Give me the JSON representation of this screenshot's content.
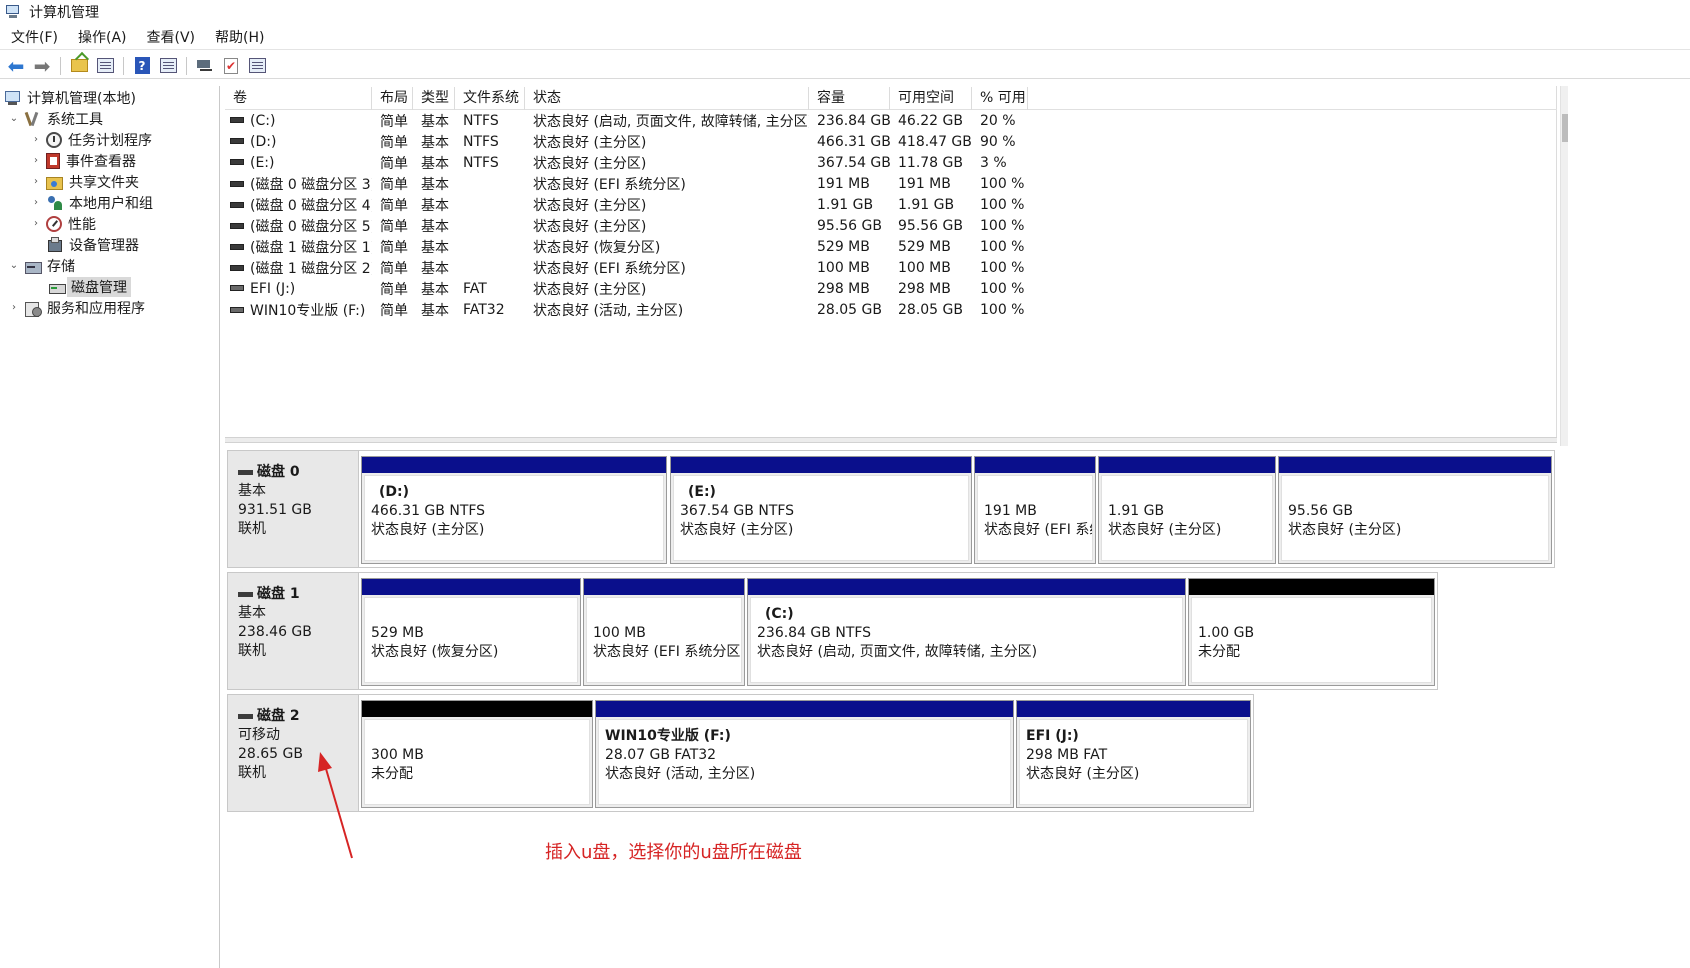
{
  "window": {
    "title": "计算机管理"
  },
  "menu": [
    "文件(F)",
    "操作(A)",
    "查看(V)",
    "帮助(H)"
  ],
  "toolbar": {
    "icons": [
      "back-arrow-icon",
      "forward-arrow-icon",
      "up-folder-icon",
      "show-tree-icon",
      "help-icon",
      "properties-icon",
      "connect-icon",
      "check-icon",
      "settings-icon"
    ]
  },
  "tree": {
    "root": "计算机管理(本地)",
    "system_tools": "系统工具",
    "task_scheduler": "任务计划程序",
    "event_viewer": "事件查看器",
    "shared_folders": "共享文件夹",
    "local_users": "本地用户和组",
    "performance": "性能",
    "device_manager": "设备管理器",
    "storage": "存储",
    "disk_management": "磁盘管理",
    "services": "服务和应用程序"
  },
  "volume_table": {
    "headers": [
      "卷",
      "布局",
      "类型",
      "文件系统",
      "状态",
      "容量",
      "可用空间",
      "% 可用"
    ],
    "rows": [
      [
        "(C:)",
        "简单",
        "基本",
        "NTFS",
        "状态良好 (启动, 页面文件, 故障转储, 主分区)",
        "236.84 GB",
        "46.22 GB",
        "20 %"
      ],
      [
        "(D:)",
        "简单",
        "基本",
        "NTFS",
        "状态良好 (主分区)",
        "466.31 GB",
        "418.47 GB",
        "90 %"
      ],
      [
        "(E:)",
        "简单",
        "基本",
        "NTFS",
        "状态良好 (主分区)",
        "367.54 GB",
        "11.78 GB",
        "3 %"
      ],
      [
        "(磁盘 0 磁盘分区 3)",
        "简单",
        "基本",
        "",
        "状态良好 (EFI 系统分区)",
        "191 MB",
        "191 MB",
        "100 %"
      ],
      [
        "(磁盘 0 磁盘分区 4)",
        "简单",
        "基本",
        "",
        "状态良好 (主分区)",
        "1.91 GB",
        "1.91 GB",
        "100 %"
      ],
      [
        "(磁盘 0 磁盘分区 5)",
        "简单",
        "基本",
        "",
        "状态良好 (主分区)",
        "95.56 GB",
        "95.56 GB",
        "100 %"
      ],
      [
        "(磁盘 1 磁盘分区 1)",
        "简单",
        "基本",
        "",
        "状态良好 (恢复分区)",
        "529 MB",
        "529 MB",
        "100 %"
      ],
      [
        "(磁盘 1 磁盘分区 2)",
        "简单",
        "基本",
        "",
        "状态良好 (EFI 系统分区)",
        "100 MB",
        "100 MB",
        "100 %"
      ],
      [
        "EFI (J:)",
        "简单",
        "基本",
        "FAT",
        "状态良好 (主分区)",
        "298 MB",
        "298 MB",
        "100 %"
      ],
      [
        "WIN10专业版 (F:)",
        "简单",
        "基本",
        "FAT32",
        "状态良好 (活动, 主分区)",
        "28.05 GB",
        "28.05 GB",
        "100 %"
      ]
    ]
  },
  "disks": [
    {
      "name": "磁盘 0",
      "type": "基本",
      "size": "931.51 GB",
      "status": "联机",
      "partitions": [
        {
          "title": "(D:)",
          "line1": "466.31 GB NTFS",
          "line2": "状态良好 (主分区)",
          "kind": "primary"
        },
        {
          "title": "(E:)",
          "line1": "367.54 GB NTFS",
          "line2": "状态良好 (主分区)",
          "kind": "primary"
        },
        {
          "title": "",
          "line1": "191 MB",
          "line2": "状态良好 (EFI 系统",
          "kind": "primary"
        },
        {
          "title": "",
          "line1": "1.91 GB",
          "line2": "状态良好 (主分区)",
          "kind": "primary"
        },
        {
          "title": "",
          "line1": "95.56 GB",
          "line2": "状态良好 (主分区)",
          "kind": "primary"
        }
      ]
    },
    {
      "name": "磁盘 1",
      "type": "基本",
      "size": "238.46 GB",
      "status": "联机",
      "partitions": [
        {
          "title": "",
          "line1": "529 MB",
          "line2": "状态良好 (恢复分区)",
          "kind": "primary"
        },
        {
          "title": "",
          "line1": "100 MB",
          "line2": "状态良好 (EFI 系统分区)",
          "kind": "primary"
        },
        {
          "title": "(C:)",
          "line1": "236.84 GB NTFS",
          "line2": "状态良好 (启动, 页面文件, 故障转储, 主分区)",
          "kind": "primary"
        },
        {
          "title": "",
          "line1": "1.00 GB",
          "line2": "未分配",
          "kind": "unalloc"
        }
      ]
    },
    {
      "name": "磁盘 2",
      "type": "可移动",
      "size": "28.65 GB",
      "status": "联机",
      "partitions": [
        {
          "title": "",
          "line1": "300 MB",
          "line2": "未分配",
          "kind": "unalloc"
        },
        {
          "title": "WIN10专业版  (F:)",
          "line1": "28.07 GB FAT32",
          "line2": "状态良好 (活动, 主分区)",
          "kind": "primary"
        },
        {
          "title": "EFI  (J:)",
          "line1": "298 MB FAT",
          "line2": "状态良好 (主分区)",
          "kind": "primary"
        }
      ]
    }
  ],
  "annotation": {
    "text": "插入u盘，选择你的u盘所在磁盘",
    "color": "#d62424"
  },
  "colors": {
    "primary_partition": "#0a0f8c",
    "unallocated": "#000000"
  }
}
